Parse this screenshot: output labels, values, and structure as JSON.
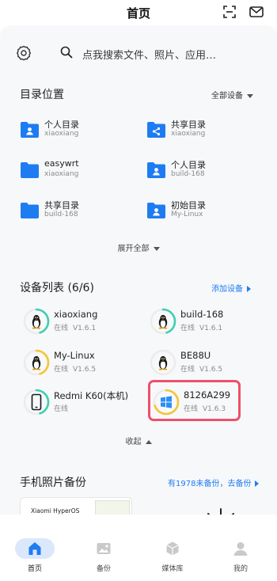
{
  "header": {
    "title": "首页"
  },
  "search": {
    "placeholder": "点我搜索文件、照片、应用…"
  },
  "directory": {
    "title": "目录位置",
    "filter_label": "全部设备",
    "expand_label": "展开全部",
    "folders": [
      {
        "name": "个人目录",
        "device": "xiaoxiang",
        "icon": "person-folder-icon"
      },
      {
        "name": "共享目录",
        "device": "xiaoxiang",
        "icon": "share-folder-icon"
      },
      {
        "name": "easywrt",
        "device": "xiaoxiang",
        "icon": "folder-icon"
      },
      {
        "name": "个人目录",
        "device": "build-168",
        "icon": "person-folder-icon"
      },
      {
        "name": "共享目录",
        "device": "build-168",
        "icon": "folder-icon"
      },
      {
        "name": "初始目录",
        "device": "My-Linux",
        "icon": "person-folder-icon"
      }
    ]
  },
  "devices": {
    "title": "设备列表 (6/6)",
    "add_label": "添加设备",
    "collapse_label": "收起",
    "items": [
      {
        "name": "xiaoxiang",
        "status": "在线",
        "version": "V1.6.1",
        "icon": "linux-penguin-icon",
        "ring_color": "#3ecfb0",
        "level": 0.45
      },
      {
        "name": "build-168",
        "status": "在线",
        "version": "V1.6.1",
        "icon": "linux-penguin-icon",
        "ring_color": "#3ecfb0",
        "level": 0.45
      },
      {
        "name": "My-Linux",
        "status": "在线",
        "version": "V1.6.5",
        "icon": "linux-penguin-icon",
        "ring_color": "#f4c534",
        "level": 0.45
      },
      {
        "name": "BE88U",
        "status": "在线",
        "version": "V1.6.5",
        "icon": "linux-penguin-icon",
        "ring_color": "#3ecfb0",
        "level": 0
      },
      {
        "name": "Redmi K60(本机)",
        "status": "在线",
        "version": "",
        "icon": "phone-icon",
        "ring_color": "#3ecfb0",
        "level": 0.45
      },
      {
        "name": "8126A299",
        "status": "在线",
        "version": "V1.6.3",
        "icon": "windows-icon",
        "ring_color": "#f4c534",
        "level": 0.7
      }
    ]
  },
  "backup": {
    "title": "手机照片备份",
    "status_label": "有1978未备份，去备份",
    "thumb_brand": "Xiaomi HyperOS"
  },
  "tabs": [
    {
      "label": "首页",
      "icon": "home-icon",
      "active": true
    },
    {
      "label": "备份",
      "icon": "photo-icon",
      "active": false
    },
    {
      "label": "媒体库",
      "icon": "cube-icon",
      "active": false
    },
    {
      "label": "我的",
      "icon": "user-icon",
      "active": false
    }
  ],
  "colors": {
    "accent": "#1e7cf2",
    "highlight": "#ef4f6b",
    "folder": "#1e7cf2"
  }
}
